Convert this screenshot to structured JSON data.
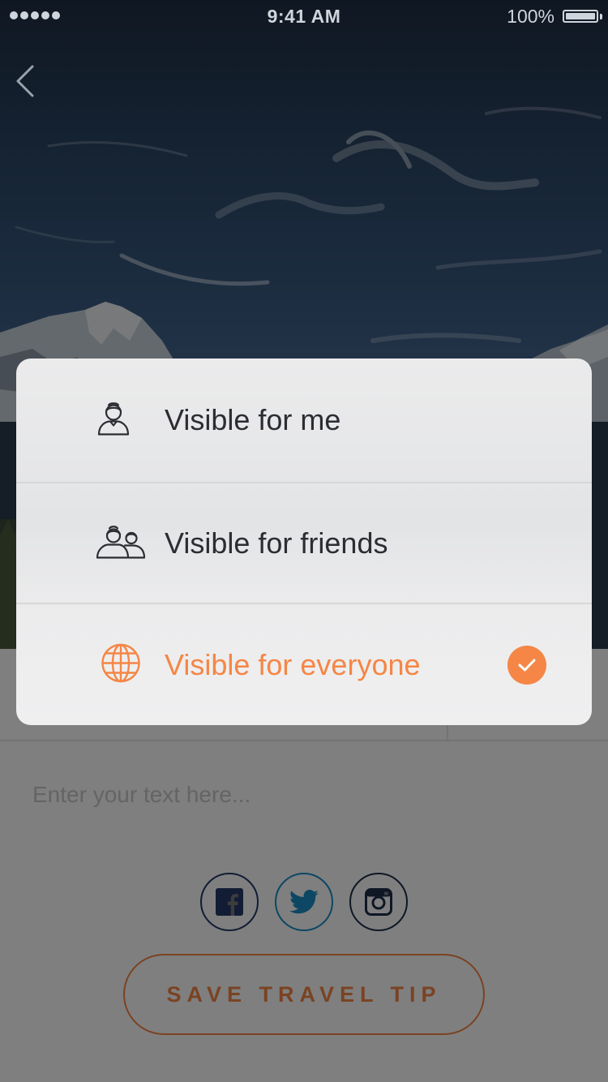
{
  "status_bar": {
    "time": "9:41 AM",
    "battery": "100%"
  },
  "nav": {
    "back_icon": "chevron-left-icon"
  },
  "editor": {
    "placeholder": "Enter your text here..."
  },
  "social": [
    {
      "name": "facebook",
      "icon": "facebook-icon",
      "color": "#253a6b"
    },
    {
      "name": "twitter",
      "icon": "twitter-icon",
      "color": "#1b8fc6"
    },
    {
      "name": "instagram",
      "icon": "instagram-icon",
      "color": "#1f2f4a"
    }
  ],
  "save_button": {
    "label": "SAVE TRAVEL TIP"
  },
  "visibility_menu": {
    "options": [
      {
        "label": "Visible for me",
        "icon": "single-user-icon",
        "selected": false
      },
      {
        "label": "Visible for friends",
        "icon": "friends-icon",
        "selected": false
      },
      {
        "label": "Visible for everyone",
        "icon": "globe-icon",
        "selected": true
      }
    ],
    "selected_icon": "checkmark-icon"
  },
  "colors": {
    "accent": "#f58646",
    "text_dark": "#2b2d33",
    "sheet_bg": "#ebebec",
    "separator": "#d6d7d9",
    "overlay": "rgba(0,0,0,0.5)"
  }
}
